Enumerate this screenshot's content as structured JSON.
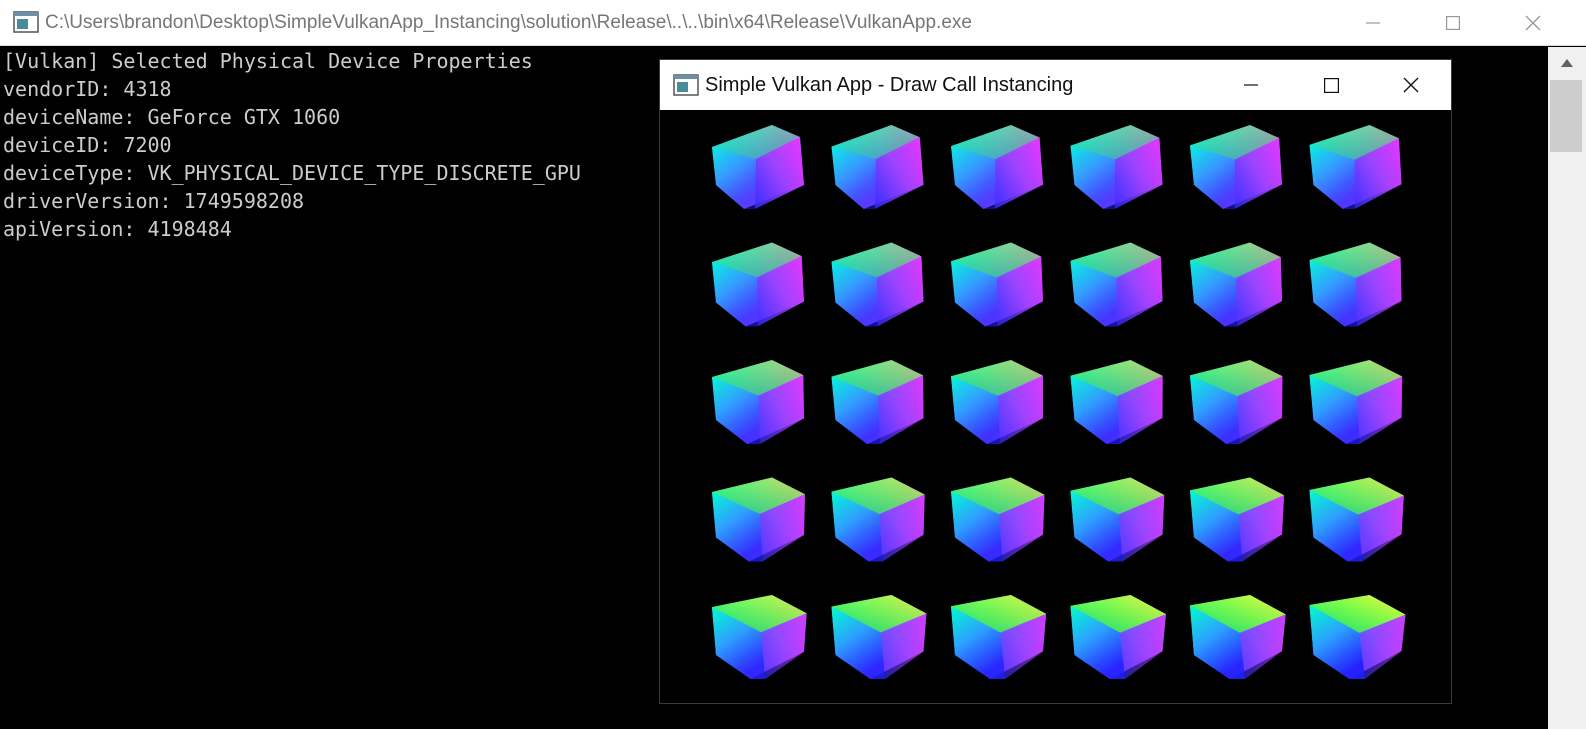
{
  "console": {
    "title": "C:\\Users\\brandon\\Desktop\\SimpleVulkanApp_Instancing\\solution\\Release\\..\\..\\bin\\x64\\Release\\VulkanApp.exe",
    "lines": [
      "[Vulkan] Selected Physical Device Properties",
      "vendorID: 4318",
      "deviceName: GeForce GTX 1060",
      "deviceID: 7200",
      "deviceType: VK_PHYSICAL_DEVICE_TYPE_DISCRETE_GPU",
      "driverVersion: 1749598208",
      "apiVersion: 4198484"
    ],
    "text_color": "#cccccc",
    "background": "#000000"
  },
  "vk_window": {
    "title": "Simple Vulkan App - Draw Call Instancing",
    "scene": {
      "rows": 5,
      "cols": 6,
      "object": "cube-icon"
    }
  },
  "colors": {
    "titlebar": "#ffffff",
    "inactive_title_text": "#767676",
    "active_title_text": "#111111",
    "scrollbar_track": "#f0f0f0",
    "scrollbar_thumb": "#cdcdcd"
  }
}
